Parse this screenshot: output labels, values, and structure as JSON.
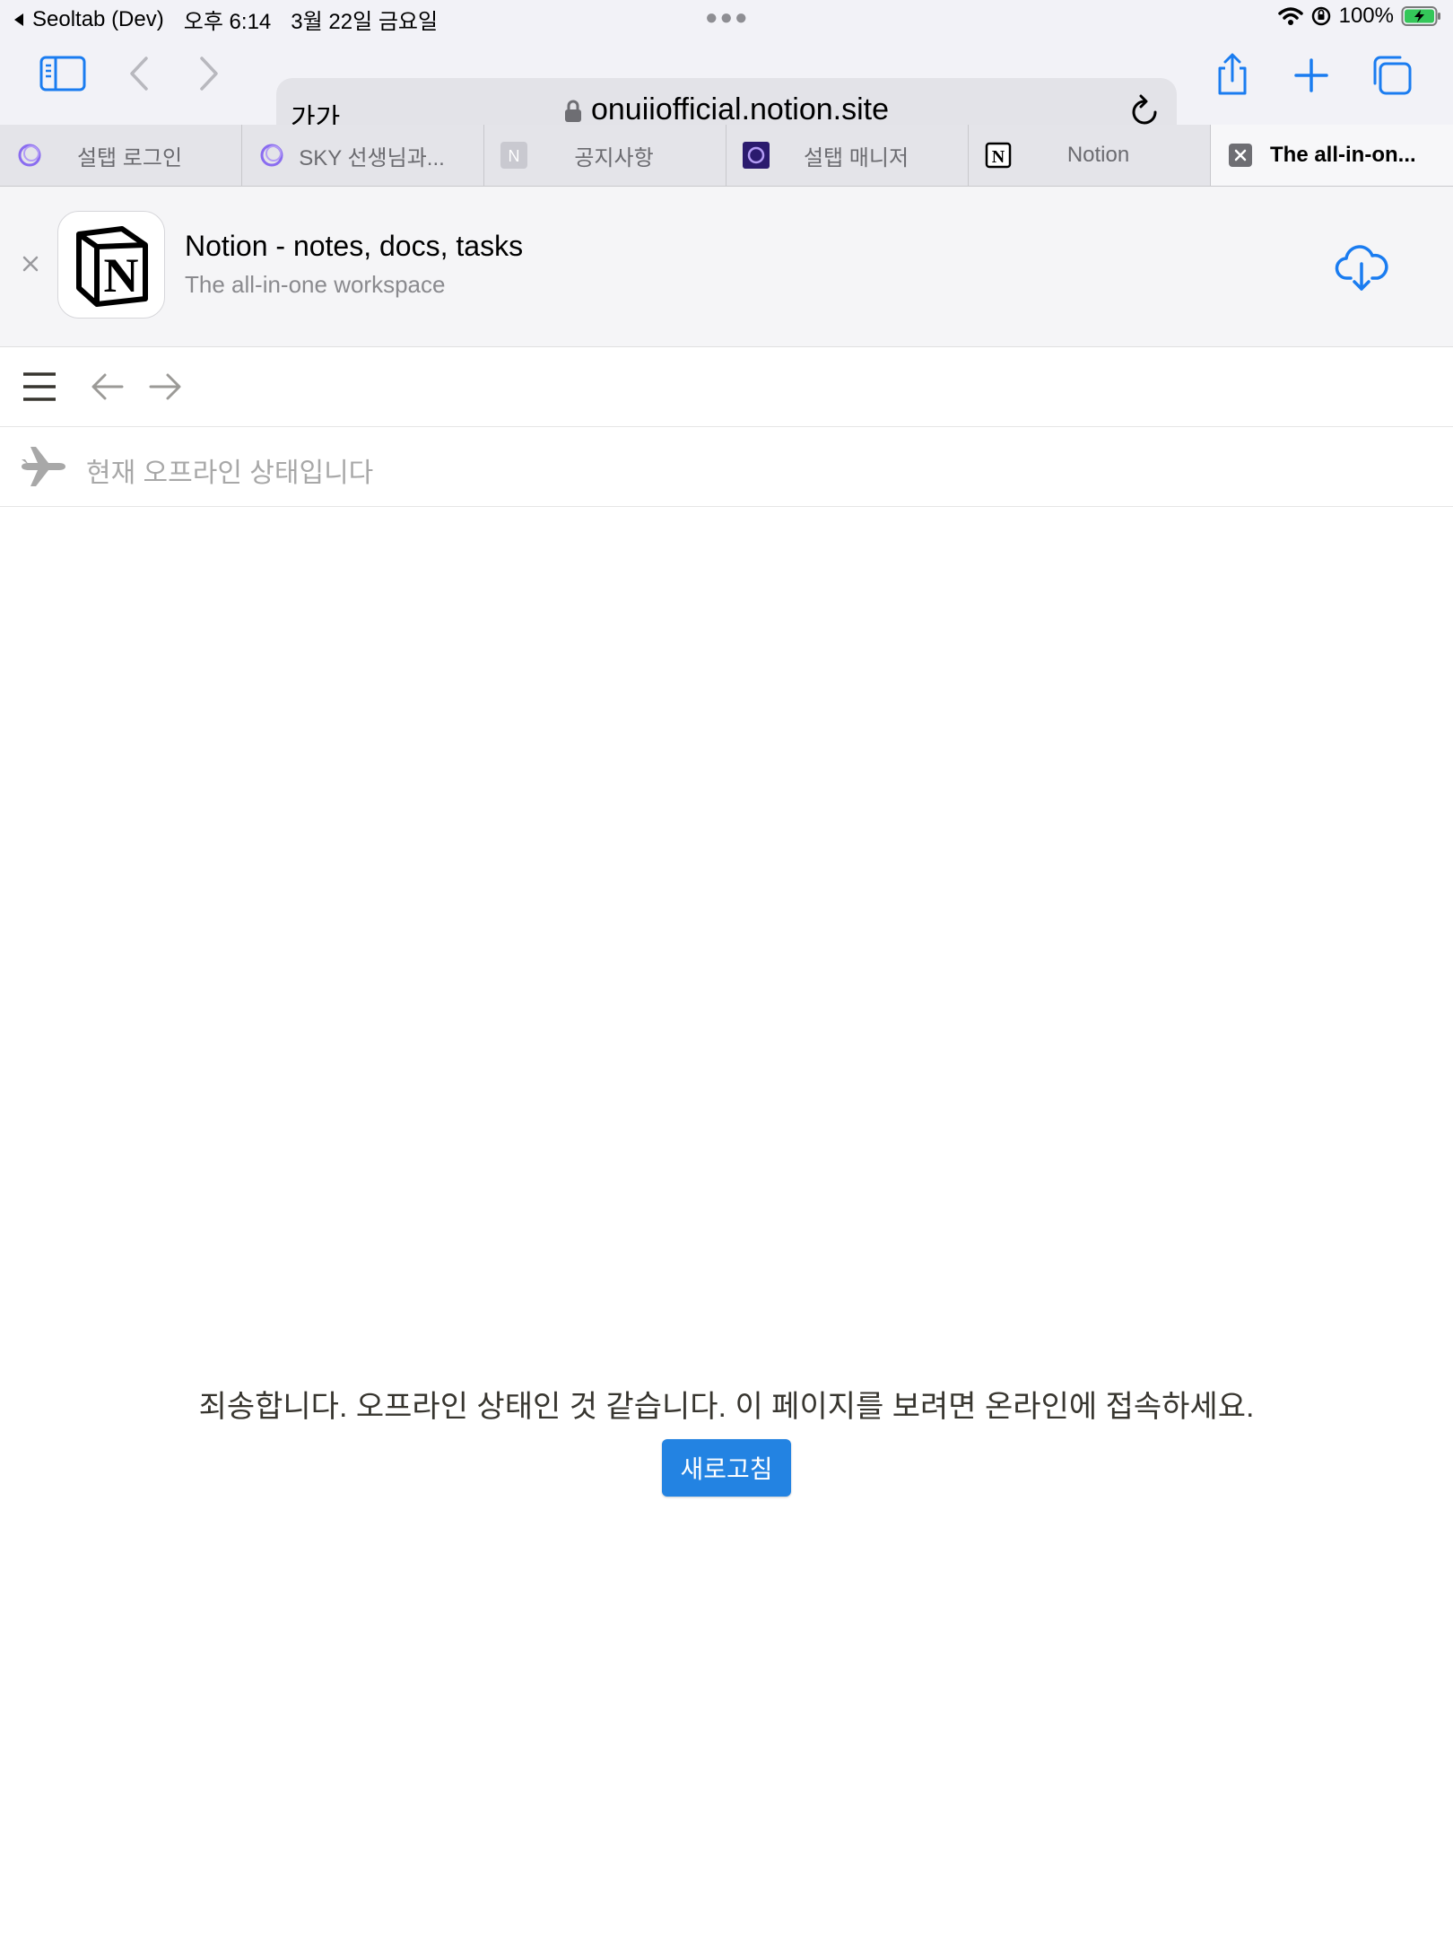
{
  "status_bar": {
    "app_back": "Seoltab (Dev)",
    "time": "오후 6:14",
    "date": "3월 22일 금요일",
    "battery": "100%"
  },
  "toolbar": {
    "text_size_label": "가가",
    "url": "onuiiofficial.notion.site"
  },
  "tabs": [
    {
      "label": "설탭 로그인",
      "icon": "seoltab-ring-icon"
    },
    {
      "label": "SKY 선생님과...",
      "icon": "seoltab-ring-icon"
    },
    {
      "label": "공지사항",
      "icon": "n-letter-icon"
    },
    {
      "label": "설탭 매니저",
      "icon": "seoltab-dark-icon"
    },
    {
      "label": "Notion",
      "icon": "notion-icon"
    },
    {
      "label": "The all-in-on...",
      "icon": "close-icon",
      "active": true
    }
  ],
  "banner": {
    "title": "Notion - notes, docs, tasks",
    "subtitle": "The all-in-one workspace"
  },
  "offline_bar": {
    "text": "현재 오프라인 상태입니다"
  },
  "main": {
    "message": "죄송합니다. 오프라인 상태인 것 같습니다. 이 페이지를 보려면 온라인에 접속하세요.",
    "refresh_label": "새로고침"
  },
  "colors": {
    "accent": "#2383e2",
    "safari_blue": "#1a7cf0",
    "chrome_bg": "#f2f2f7"
  }
}
